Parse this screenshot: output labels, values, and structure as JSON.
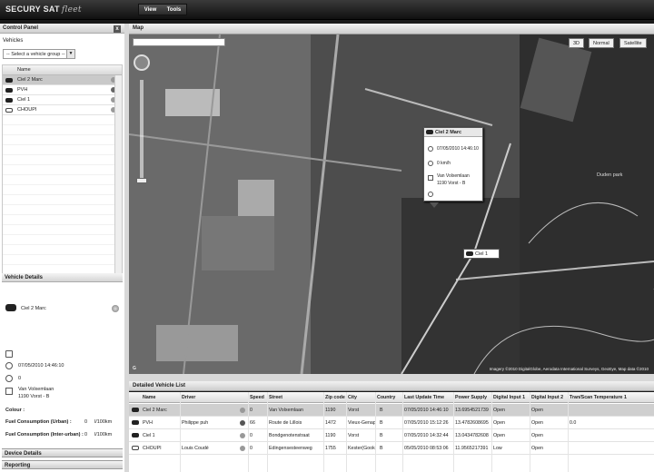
{
  "app": {
    "logo_main": "SECURY SAT",
    "logo_suffix": "fleet",
    "menu": [
      "View",
      "Tools"
    ]
  },
  "control_panel": {
    "title": "Control Panel",
    "close_label": "x",
    "vehicles_label": "Vehicles",
    "group_select_value": "-- Select a vehicle group --",
    "list_header_name": "Name",
    "vehicles": [
      {
        "name": "Ciel 2 Marc",
        "selected": true
      },
      {
        "name": "PVH",
        "selected": false
      },
      {
        "name": "Ciel 1",
        "selected": false
      },
      {
        "name": "CHOUPI",
        "selected": false
      }
    ]
  },
  "vehicle_details": {
    "title": "Vehicle Details",
    "name": "Ciel 2 Marc",
    "datetime": "07/05/2010 14:46:10",
    "speed": "0",
    "address_line1": "Van Volxemlaan",
    "address_line2": "1190 Vorst - B",
    "colour_label": "Colour :",
    "fuel_urban_label": "Fuel Consumption (Urban) :",
    "fuel_urban_value": "0",
    "fuel_urban_unit": "l/100km",
    "fuel_inter_label": "Fuel Consumption (Inter-urban) :",
    "fuel_inter_value": "0",
    "fuel_inter_unit": "l/100km"
  },
  "bottom_panels": {
    "device_details": "Device Details",
    "reporting": "Reporting"
  },
  "map": {
    "title": "Map",
    "type_buttons": [
      "3D",
      "Normal",
      "Satellite"
    ],
    "info_window": {
      "name": "Ciel 2 Marc",
      "datetime": "07/05/2010 14:46:10",
      "speed": "0 km/h",
      "address_line1": "Van Volxemlaan",
      "address_line2": "1190 Vorst - B"
    },
    "marker_label": "Ciel 1",
    "park_label": "Duden park",
    "copyright": "Imagery ©2010 DigitalGlobe, Aerodata International Surveys, GeoEye, Map data ©2010"
  },
  "detailed_list": {
    "title": "Detailed Vehicle List",
    "columns": [
      "Name",
      "Driver",
      "Speed",
      "Street",
      "Zip code",
      "City",
      "Country",
      "Last Update Time",
      "Power Supply",
      "Digital Input 1",
      "Digital Input 2",
      "Tran/Scan Temperature 1"
    ],
    "rows": [
      {
        "name": "Ciel 2 Marc",
        "driver": "",
        "speed": "0",
        "street": "Van Volxemlaan",
        "zip": "1190",
        "city": "Vorst",
        "country": "B",
        "time": "07/05/2010 14:46:10",
        "power": "13.6954521739",
        "din1": "Open",
        "din2": "Open",
        "temp": "",
        "selected": true,
        "white": false
      },
      {
        "name": "PVH",
        "driver": "Philippe puh",
        "speed": "66",
        "street": "Route de Lillois",
        "zip": "1472",
        "city": "Vieux-Genap",
        "country": "B",
        "time": "07/05/2010 15:12:26",
        "power": "13.4782608695",
        "din1": "Open",
        "din2": "Open",
        "temp": "0.0",
        "selected": false,
        "white": false
      },
      {
        "name": "Ciel 1",
        "driver": "",
        "speed": "0",
        "street": "Bondgenotenstraat",
        "zip": "1190",
        "city": "Vorst",
        "country": "B",
        "time": "07/05/2010 14:32:44",
        "power": "13.0434782608",
        "din1": "Open",
        "din2": "Open",
        "temp": "",
        "selected": false,
        "white": false
      },
      {
        "name": "CHOUPI",
        "driver": "Louis Coudé",
        "speed": "0",
        "street": "Edingensesteenweg",
        "zip": "1755",
        "city": "Kester(Gook",
        "country": "B",
        "time": "05/05/2010 08:53:06",
        "power": "11.9565217391",
        "din1": "Low",
        "din2": "Open",
        "temp": "",
        "selected": false,
        "white": true
      }
    ]
  }
}
